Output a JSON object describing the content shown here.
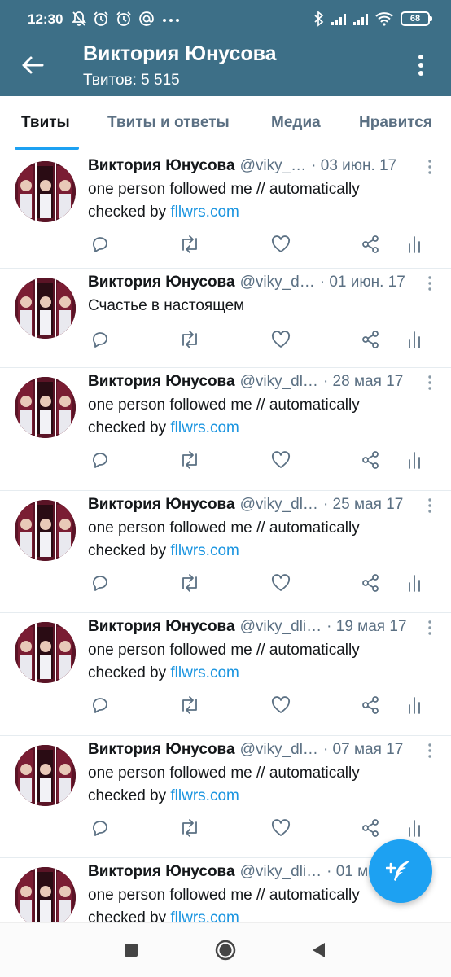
{
  "status_bar": {
    "time": "12:30",
    "left_icons": [
      "notifications-off-icon",
      "alarm-icon",
      "alarm-icon",
      "at-icon",
      "more-icon"
    ],
    "right_icons": [
      "bluetooth-icon",
      "signal-icon",
      "signal-icon",
      "wifi-icon"
    ],
    "battery": "68"
  },
  "header": {
    "title": "Виктория Юнусова",
    "subtitle": "Твитов: 5 515",
    "bg_color": "#3d6f87"
  },
  "tabs": [
    {
      "label": "Твиты",
      "active": true
    },
    {
      "label": "Твиты и ответы",
      "active": false
    },
    {
      "label": "Медиа",
      "active": false
    },
    {
      "label": "Нравится",
      "active": false
    }
  ],
  "tweets": [
    {
      "name": "Виктория Юнусова",
      "handle": "@viky_…",
      "date": "· 03 июн. 17",
      "text": "one person followed me // automatically checked by ",
      "link": "fllwrs.com"
    },
    {
      "name": "Виктория Юнусова",
      "handle": "@viky_d…",
      "date": "· 01 июн. 17",
      "text": "Счастье в настоящем",
      "link": ""
    },
    {
      "name": "Виктория Юнусова",
      "handle": "@viky_dl…",
      "date": "· 28 мая 17",
      "text": "one person followed me // automatically checked by ",
      "link": "fllwrs.com"
    },
    {
      "name": "Виктория Юнусова",
      "handle": "@viky_dl…",
      "date": "· 25 мая 17",
      "text": "one person followed me // automatically checked by ",
      "link": "fllwrs.com"
    },
    {
      "name": "Виктория Юнусова",
      "handle": "@viky_dli…",
      "date": "· 19 мая 17",
      "text": "one person followed me // automatically checked by ",
      "link": "fllwrs.com"
    },
    {
      "name": "Виктория Юнусова",
      "handle": "@viky_dl…",
      "date": "· 07 мая 17",
      "text": "one person followed me // automatically checked by ",
      "link": "fllwrs.com"
    },
    {
      "name": "Виктория Юнусова",
      "handle": "@viky_dli…",
      "date": "· 01 м",
      "text": "one person followed me // automatically checked by ",
      "link": "fllwrs.com"
    }
  ],
  "tweet_actions": [
    "reply-icon",
    "retweet-icon",
    "like-icon",
    "share-icon",
    "analytics-icon"
  ],
  "fab": {
    "icon": "compose-tweet-icon",
    "color": "#1da1f2"
  },
  "nav_bar": [
    "recents-icon",
    "home-icon",
    "back-icon"
  ]
}
